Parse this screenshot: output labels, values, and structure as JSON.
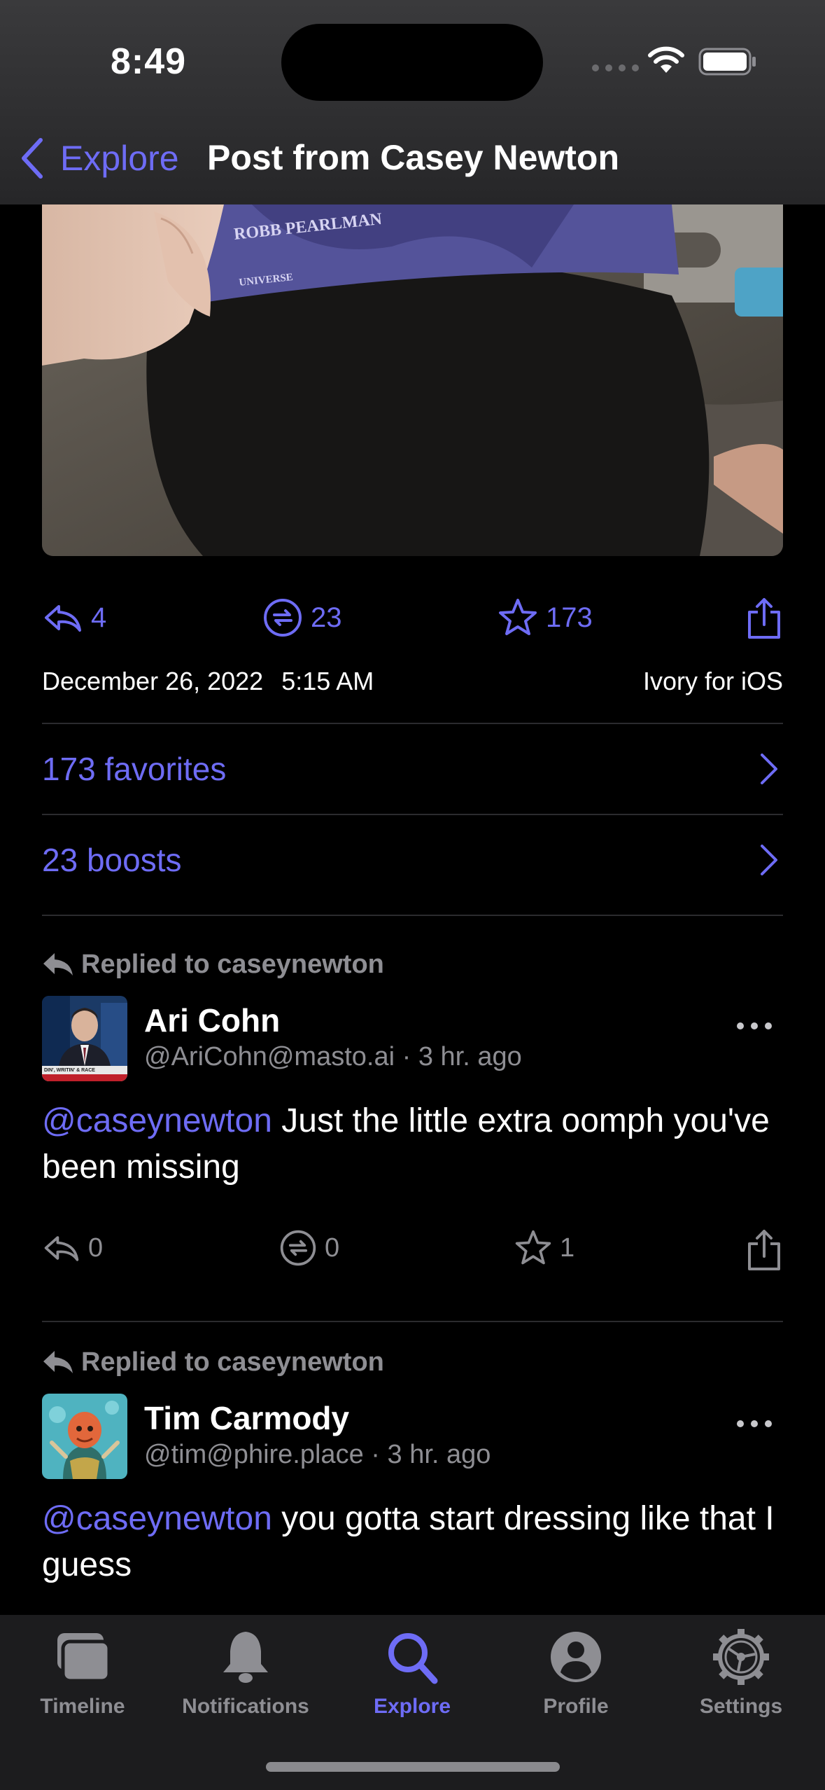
{
  "status_bar": {
    "time": "8:49"
  },
  "nav": {
    "back_label": "Explore",
    "title": "Post from Casey Newton"
  },
  "post": {
    "image_text": {
      "author": "ROBB PEARLMAN",
      "publisher": "UNIVERSE"
    },
    "replies": "4",
    "boosts": "23",
    "favorites": "173",
    "date": "December 26, 2022",
    "time": "5:15 AM",
    "client": "Ivory for iOS",
    "favorites_link": "173 favorites",
    "boosts_link": "23 boosts"
  },
  "replies": [
    {
      "replied_to": "Replied to caseynewton",
      "name": "Ari Cohn",
      "handle": "@AriCohn@masto.ai",
      "separator": "·",
      "age": "3 hr. ago",
      "mention": "@caseynewton",
      "text": " Just the little extra oomph you've been missing",
      "reply_count": "0",
      "boost_count": "0",
      "fav_count": "1",
      "avatar_caption": "DIN', WRITIN' & RACE"
    },
    {
      "replied_to": "Replied to caseynewton",
      "name": "Tim Carmody",
      "handle": "@tim@phire.place",
      "separator": "·",
      "age": "3 hr. ago",
      "mention": "@caseynewton",
      "text": " you gotta start dressing like that I guess"
    }
  ],
  "tabs": [
    {
      "label": "Timeline",
      "icon": "timeline-icon"
    },
    {
      "label": "Notifications",
      "icon": "bell-icon"
    },
    {
      "label": "Explore",
      "icon": "search-icon",
      "active": true
    },
    {
      "label": "Profile",
      "icon": "profile-icon"
    },
    {
      "label": "Settings",
      "icon": "gear-icon"
    }
  ],
  "colors": {
    "accent": "#6e6cf5",
    "secondary": "#8e8e93",
    "background": "#000000",
    "tabbar": "#1c1c1e"
  }
}
